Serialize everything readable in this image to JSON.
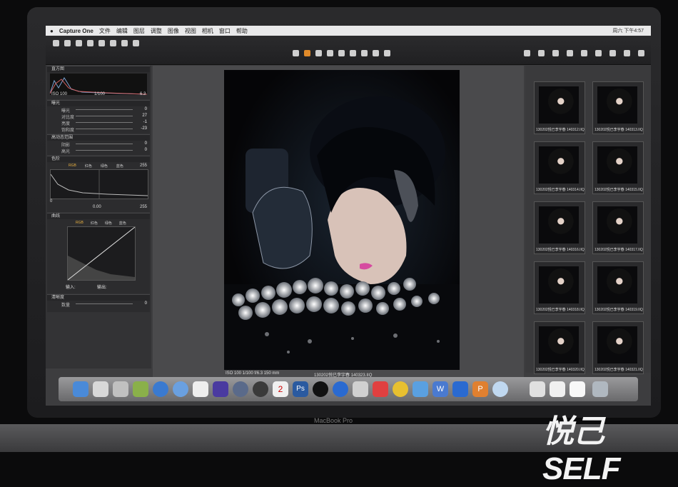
{
  "menubar": {
    "app": "Capture One",
    "items": [
      "文件",
      "编辑",
      "图层",
      "调整",
      "图像",
      "视图",
      "相机",
      "窗口",
      "帮助"
    ],
    "clock": "周六 下午4:57"
  },
  "viewer": {
    "title": "130202悦已李宇春",
    "caption_left": "ISO 100  1/100  f/6.3  150 mm",
    "caption_right": "130202悦已李宇春 140323.IIQ"
  },
  "left_panel": {
    "histogram": {
      "iso": "ISO 100",
      "shutter": "1/100",
      "aperture": "6.3"
    },
    "exposure": {
      "title": "曝光",
      "rows": [
        {
          "label": "曝光",
          "value": "0"
        },
        {
          "label": "对比度",
          "value": "27"
        },
        {
          "label": "亮度",
          "value": "-1"
        },
        {
          "label": "饱和度",
          "value": "-23"
        }
      ]
    },
    "hdr": {
      "title": "高动态范围",
      "rows": [
        {
          "label": "阴影",
          "value": "0"
        },
        {
          "label": "高光",
          "value": "0"
        }
      ]
    },
    "levels": {
      "title": "色阶",
      "tabs": [
        "RGB",
        "红色",
        "绿色",
        "蓝色"
      ],
      "max": "255",
      "min": "0",
      "mid": "0.00",
      "max2": "255"
    },
    "curve": {
      "title": "曲线",
      "tabs": [
        "RGB",
        "红色",
        "绿色",
        "蓝色"
      ],
      "input": "输入:",
      "output": "输出:"
    },
    "clarity": {
      "title": "清晰度",
      "row_label": "数量",
      "row_value": "0"
    }
  },
  "browser": {
    "thumbs": [
      "130202悦已李宇春 140312.IIQ",
      "130202悦已李宇春 140313.IIQ",
      "130202悦已李宇春 140314.IIQ",
      "130202悦已李宇春 140315.IIQ",
      "130202悦已李宇春 140316.IIQ",
      "130202悦已李宇春 140317.IIQ",
      "130202悦已李宇春 140318.IIQ",
      "130202悦已李宇春 140319.IIQ",
      "130202悦已李宇春 140320.IIQ",
      "130202悦已李宇春 140321.IIQ",
      "",
      ""
    ]
  },
  "laptop_label": "MacBook Pro",
  "watermark": "悦己SELF",
  "dock": {
    "calendar_day": "2"
  }
}
